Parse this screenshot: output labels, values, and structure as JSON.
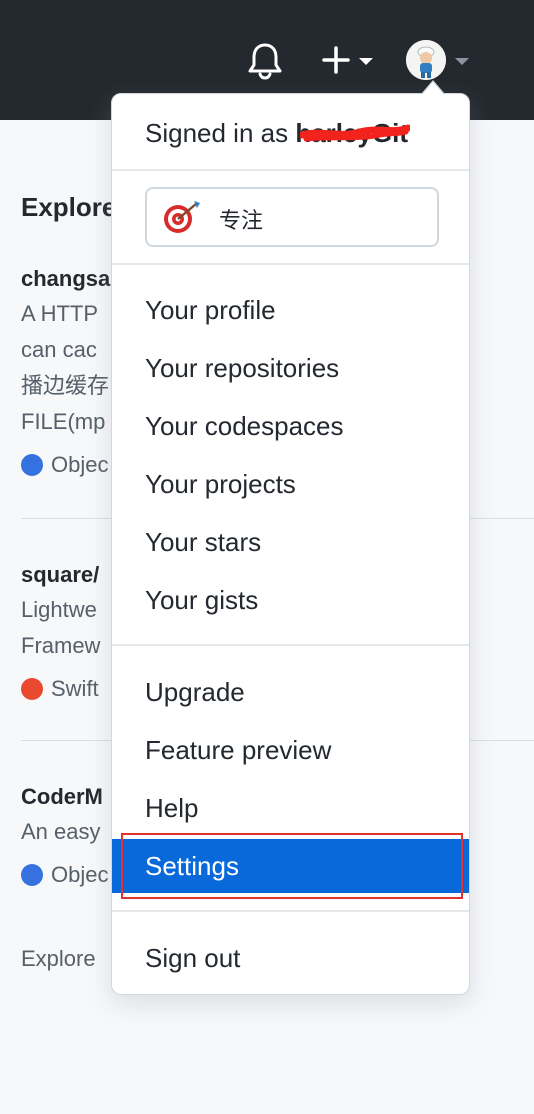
{
  "header": {
    "notifications_icon": "bell-icon",
    "create_icon": "plus-icon",
    "colors": {
      "bar": "#24292f",
      "icon": "#ffffff"
    }
  },
  "background": {
    "title": "Explore",
    "repos": [
      {
        "name": "changsa",
        "desc": [
          "A HTTP",
          "can cac",
          "播边缓存",
          "FILE(mp"
        ],
        "lang": "Objec",
        "lang_color": "#3572e0"
      },
      {
        "name": "square/",
        "desc": [
          "Lightwe",
          "Framew"
        ],
        "lang": "Swift",
        "lang_color": "#e8492f"
      },
      {
        "name": "CoderM",
        "desc": [
          "An easy"
        ],
        "lang": "Objec",
        "lang_color": "#3572e0"
      }
    ],
    "explore_more": "Explore"
  },
  "dropdown": {
    "signed_in_prefix": "Signed in as ",
    "username": "harleyGit",
    "status": {
      "icon": "target-icon",
      "text": "专注"
    },
    "section1": [
      "Your profile",
      "Your repositories",
      "Your codespaces",
      "Your projects",
      "Your stars",
      "Your gists"
    ],
    "section2": [
      "Upgrade",
      "Feature preview",
      "Help",
      "Settings"
    ],
    "signout": "Sign out",
    "active_item": "Settings",
    "colors": {
      "active_bg": "#0969da",
      "highlight_frame": "#e5322d"
    }
  }
}
